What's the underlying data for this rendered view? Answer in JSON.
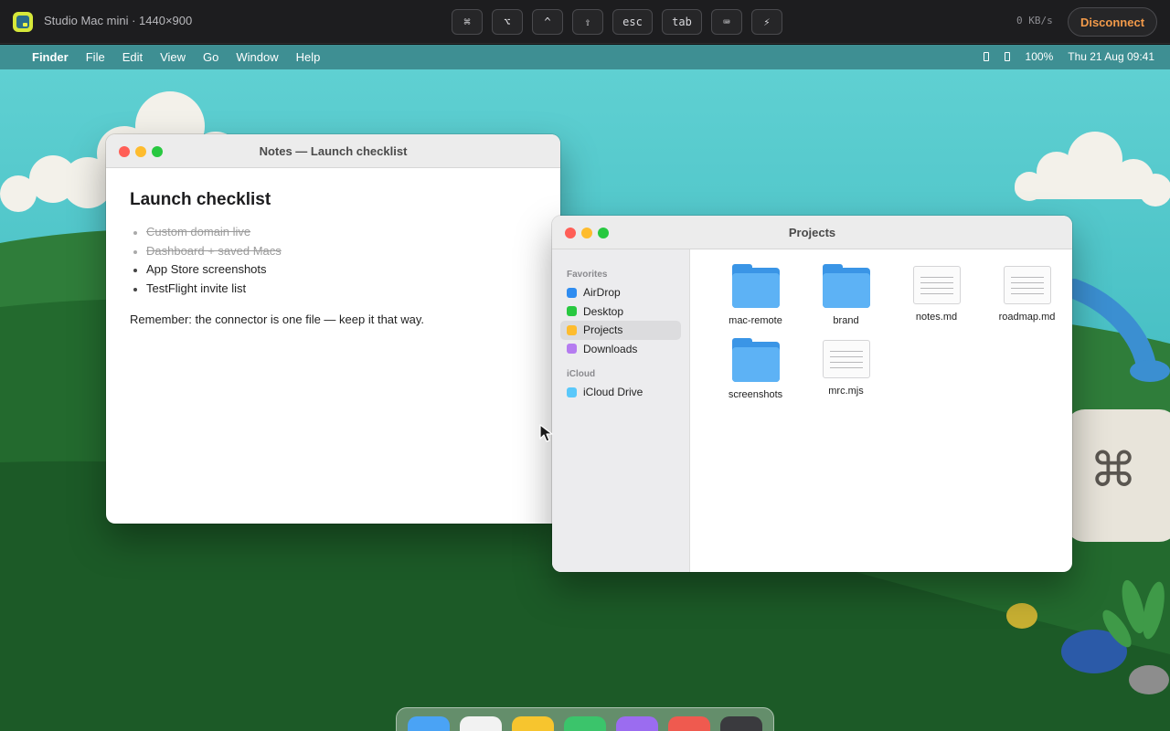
{
  "remote": {
    "host_title": "Studio Mac mini · 1440×900",
    "keys": [
      "⌘",
      "⌥",
      "^",
      "⇧",
      "esc",
      "tab",
      "⌨",
      "⚡"
    ],
    "throughput": "0 KB/s",
    "disconnect_label": "Disconnect",
    "accent": "#f29a4a"
  },
  "menubar": {
    "app": "Finder",
    "items": [
      "File",
      "Edit",
      "View",
      "Go",
      "Window",
      "Help"
    ],
    "battery": "100%",
    "datetime": "Thu 21 Aug  09:41"
  },
  "notes_window": {
    "title": "Notes — Launch checklist",
    "heading": "Launch checklist",
    "items": [
      {
        "text": "Custom domain live",
        "done": true
      },
      {
        "text": "Dashboard + saved Macs",
        "done": true
      },
      {
        "text": "App Store screenshots",
        "done": false
      },
      {
        "text": "TestFlight invite list",
        "done": false
      }
    ],
    "note": "Remember: the connector is one file — keep it that way."
  },
  "finder_window": {
    "title": "Projects",
    "sections": [
      {
        "heading": "Favorites",
        "items": [
          {
            "label": "AirDrop",
            "color": "#2f8cf0",
            "selected": false
          },
          {
            "label": "Desktop",
            "color": "#28c840",
            "selected": false
          },
          {
            "label": "Projects",
            "color": "#febc2e",
            "selected": true
          },
          {
            "label": "Downloads",
            "color": "#b57cf0",
            "selected": false
          }
        ]
      },
      {
        "heading": "iCloud",
        "items": [
          {
            "label": "iCloud Drive",
            "color": "#5ac8fa",
            "selected": false
          }
        ]
      }
    ],
    "files": [
      {
        "name": "mac-remote",
        "kind": "folder"
      },
      {
        "name": "brand",
        "kind": "folder"
      },
      {
        "name": "notes.md",
        "kind": "document"
      },
      {
        "name": "roadmap.md",
        "kind": "document"
      },
      {
        "name": "screenshots",
        "kind": "folder"
      },
      {
        "name": "mrc.mjs",
        "kind": "document"
      }
    ]
  },
  "dock": {
    "icon_colors": [
      "#4aa3f5",
      "#f2f2f2",
      "#f7c52e",
      "#3bc46b",
      "#9b6cf0",
      "#ef5a4f",
      "#3a3a3e"
    ]
  }
}
